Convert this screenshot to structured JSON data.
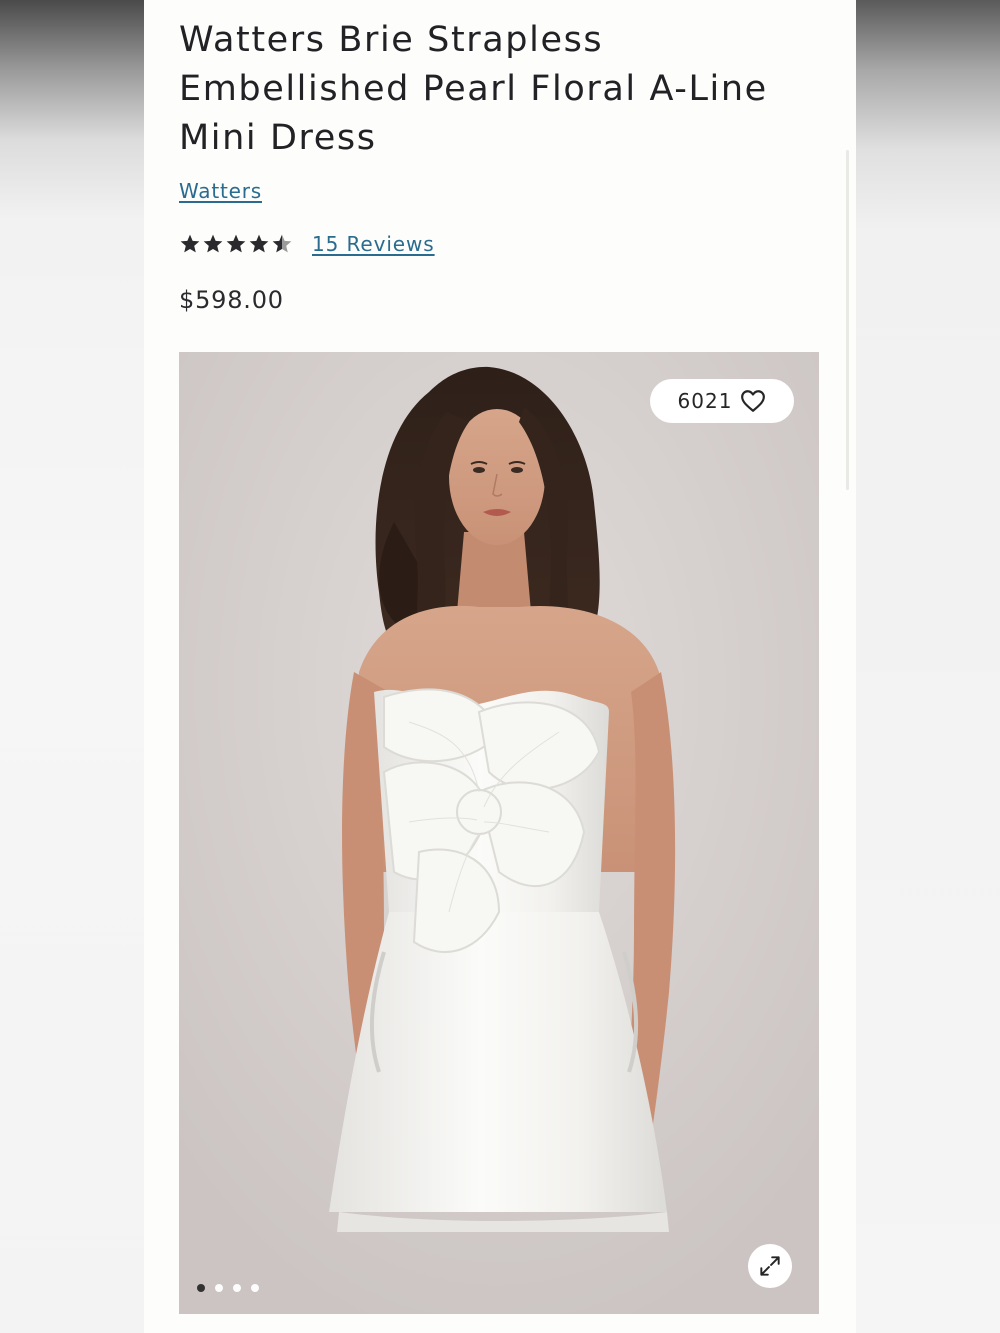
{
  "product": {
    "title": "Watters Brie Strapless Embellished Pearl Floral A-Line Mini Dress",
    "brand": "Watters",
    "rating": 4.5,
    "rating_max": 5,
    "reviews_label": "15 Reviews",
    "price": "$598.00"
  },
  "gallery": {
    "favorite_count": "6021",
    "favorite_icon": "heart-outline-icon",
    "expand_icon": "expand-arrows-icon",
    "slide_count": 4,
    "active_slide": 1
  },
  "colors": {
    "link": "#2a6c8f",
    "text": "#222226",
    "star_filled": "#2a2a2e",
    "star_empty": "#9a9a9a"
  }
}
